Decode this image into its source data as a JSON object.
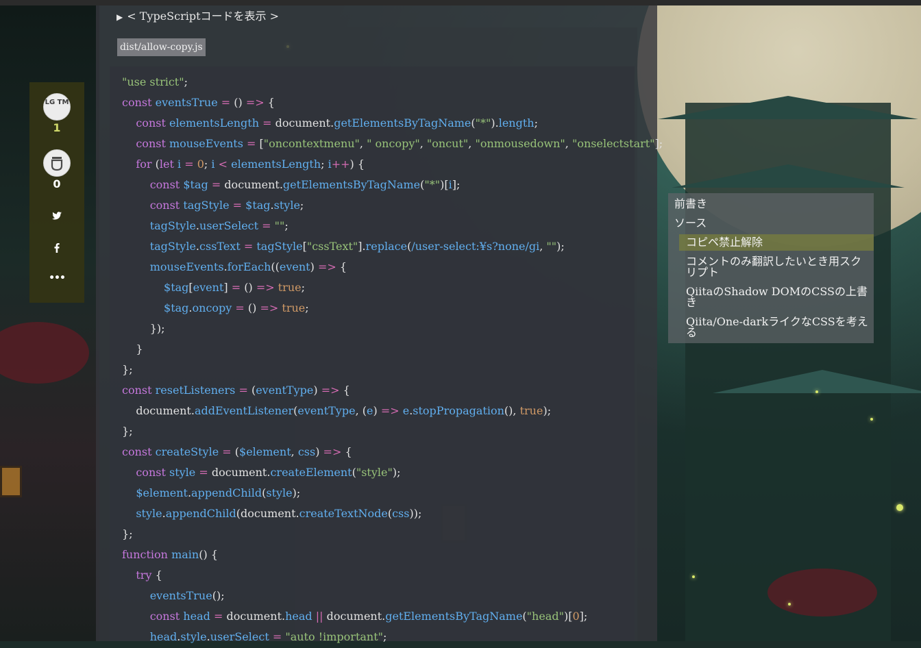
{
  "details": {
    "summary_label": "< TypeScriptコードを表示 >"
  },
  "file": {
    "name": "dist/allow-copy.js"
  },
  "code_lines": [
    "\"use strict\";",
    "const eventsTrue = () => {",
    "    const elementsLength = document.getElementsByTagName(\"*\").length;",
    "    const mouseEvents = [\"oncontextmenu\", \" oncopy\", \"oncut\", \"onmousedown\", \"onselectstart\"];",
    "    for (let i = 0; i < elementsLength; i++) {",
    "        const $tag = document.getElementsByTagName(\"*\")[i];",
    "        const tagStyle = $tag.style;",
    "        tagStyle.userSelect = \"\";",
    "        tagStyle.cssText = tagStyle[\"cssText\"].replace(/user-select:¥s?none/gi, \"\");",
    "        mouseEvents.forEach((event) => {",
    "            $tag[event] = () => true;",
    "            $tag.oncopy = () => true;",
    "        });",
    "    }",
    "};",
    "const resetListeners = (eventType) => {",
    "    document.addEventListener(eventType, (e) => e.stopPropagation(), true);",
    "};",
    "const createStyle = ($element, css) => {",
    "    const style = document.createElement(\"style\");",
    "    $element.appendChild(style);",
    "    style.appendChild(document.createTextNode(css));",
    "};",
    "function main() {",
    "    try {",
    "        eventsTrue();",
    "        const head = document.head || document.getElementsByTagName(\"head\")[0];",
    "        head.style.userSelect = \"auto !important\";"
  ],
  "sidebar": {
    "lgtm_label": "LG TM",
    "lgtm_count": "1",
    "stock_count": "0",
    "twitter_icon": "twitter-icon",
    "facebook_icon": "facebook-icon",
    "more_icon": "more-icon"
  },
  "toc": {
    "items": [
      {
        "label": "前書き"
      },
      {
        "label": "ソース"
      },
      {
        "label": "コピペ禁止解除"
      },
      {
        "label": "コメントのみ翻訳したいとき用スクリプト"
      },
      {
        "label": "QiitaのShadow DOMのCSSの上書き"
      },
      {
        "label": "Qiita/One-darkライクなCSSを考える"
      }
    ]
  },
  "colors": {
    "code_keyword": "#c678dd",
    "code_identifier": "#61afef",
    "code_string": "#98c379",
    "code_number": "#d19a66",
    "lgtm_count": "#cfd86a",
    "toc_active": "#787e3c"
  }
}
